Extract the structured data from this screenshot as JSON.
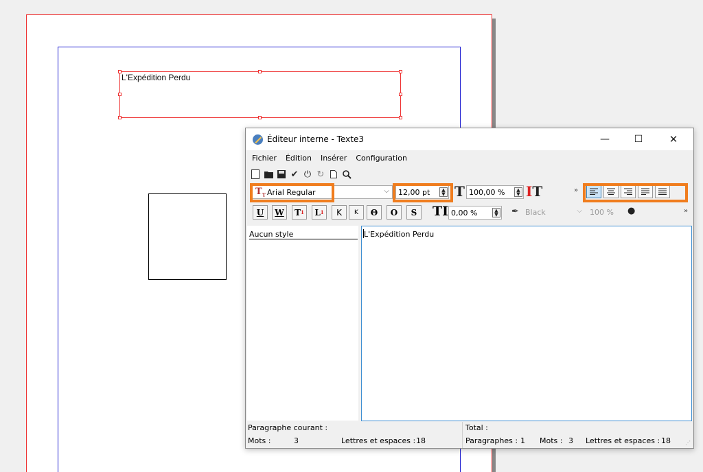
{
  "document": {
    "title_frame_text": "L'Expédition Perdu"
  },
  "editor": {
    "window_title": "Éditeur interne - Texte3",
    "controls": {
      "minimize": "—",
      "maximize": "☐",
      "close": "✕"
    },
    "menu": [
      "Fichier",
      "Édition",
      "Insérer",
      "Configuration"
    ],
    "toolbar_icons": [
      "new-doc-icon",
      "folder-icon",
      "save-icon",
      "check-icon",
      "power-icon",
      "redo-icon",
      "page-icon",
      "search-icon"
    ],
    "font": {
      "value": "Arial Regular",
      "arrow": "⌵"
    },
    "font_size": {
      "value": "12,00 pt"
    },
    "horizontal_scale": {
      "value": "100,00 %"
    },
    "overflow": "»",
    "alignment": {
      "active": "left",
      "options": [
        "left",
        "center",
        "right",
        "justify",
        "force-justify"
      ]
    },
    "style_buttons": [
      "U",
      "W",
      "T",
      "L",
      "K",
      "K",
      "Θ",
      "O",
      "S"
    ],
    "letter_spacing": {
      "value": "0,00 %"
    },
    "text_color": {
      "value": "Black"
    },
    "shade": {
      "value": "100 %"
    },
    "style_list": [
      "Aucun style"
    ],
    "text_content": "L'Expédition Perdu",
    "status": {
      "current_paragraph_label": "Paragraphe courant :",
      "words_label": "Mots :",
      "words_value": "3",
      "letters_label": "Lettres et espaces :",
      "letters_value": "18",
      "total_label": "Total :",
      "paragraphs_label": "Paragraphes :",
      "paragraphs_value": "1",
      "total_words_label": "Mots :",
      "total_words_value": "3",
      "total_letters_label": "Lettres et espaces :",
      "total_letters_value": "18"
    }
  },
  "colors": {
    "highlight": "#f07d1e",
    "frame_red": "#e33333",
    "margin_blue": "#1a1ad0",
    "active_align": "#cce4f7"
  }
}
